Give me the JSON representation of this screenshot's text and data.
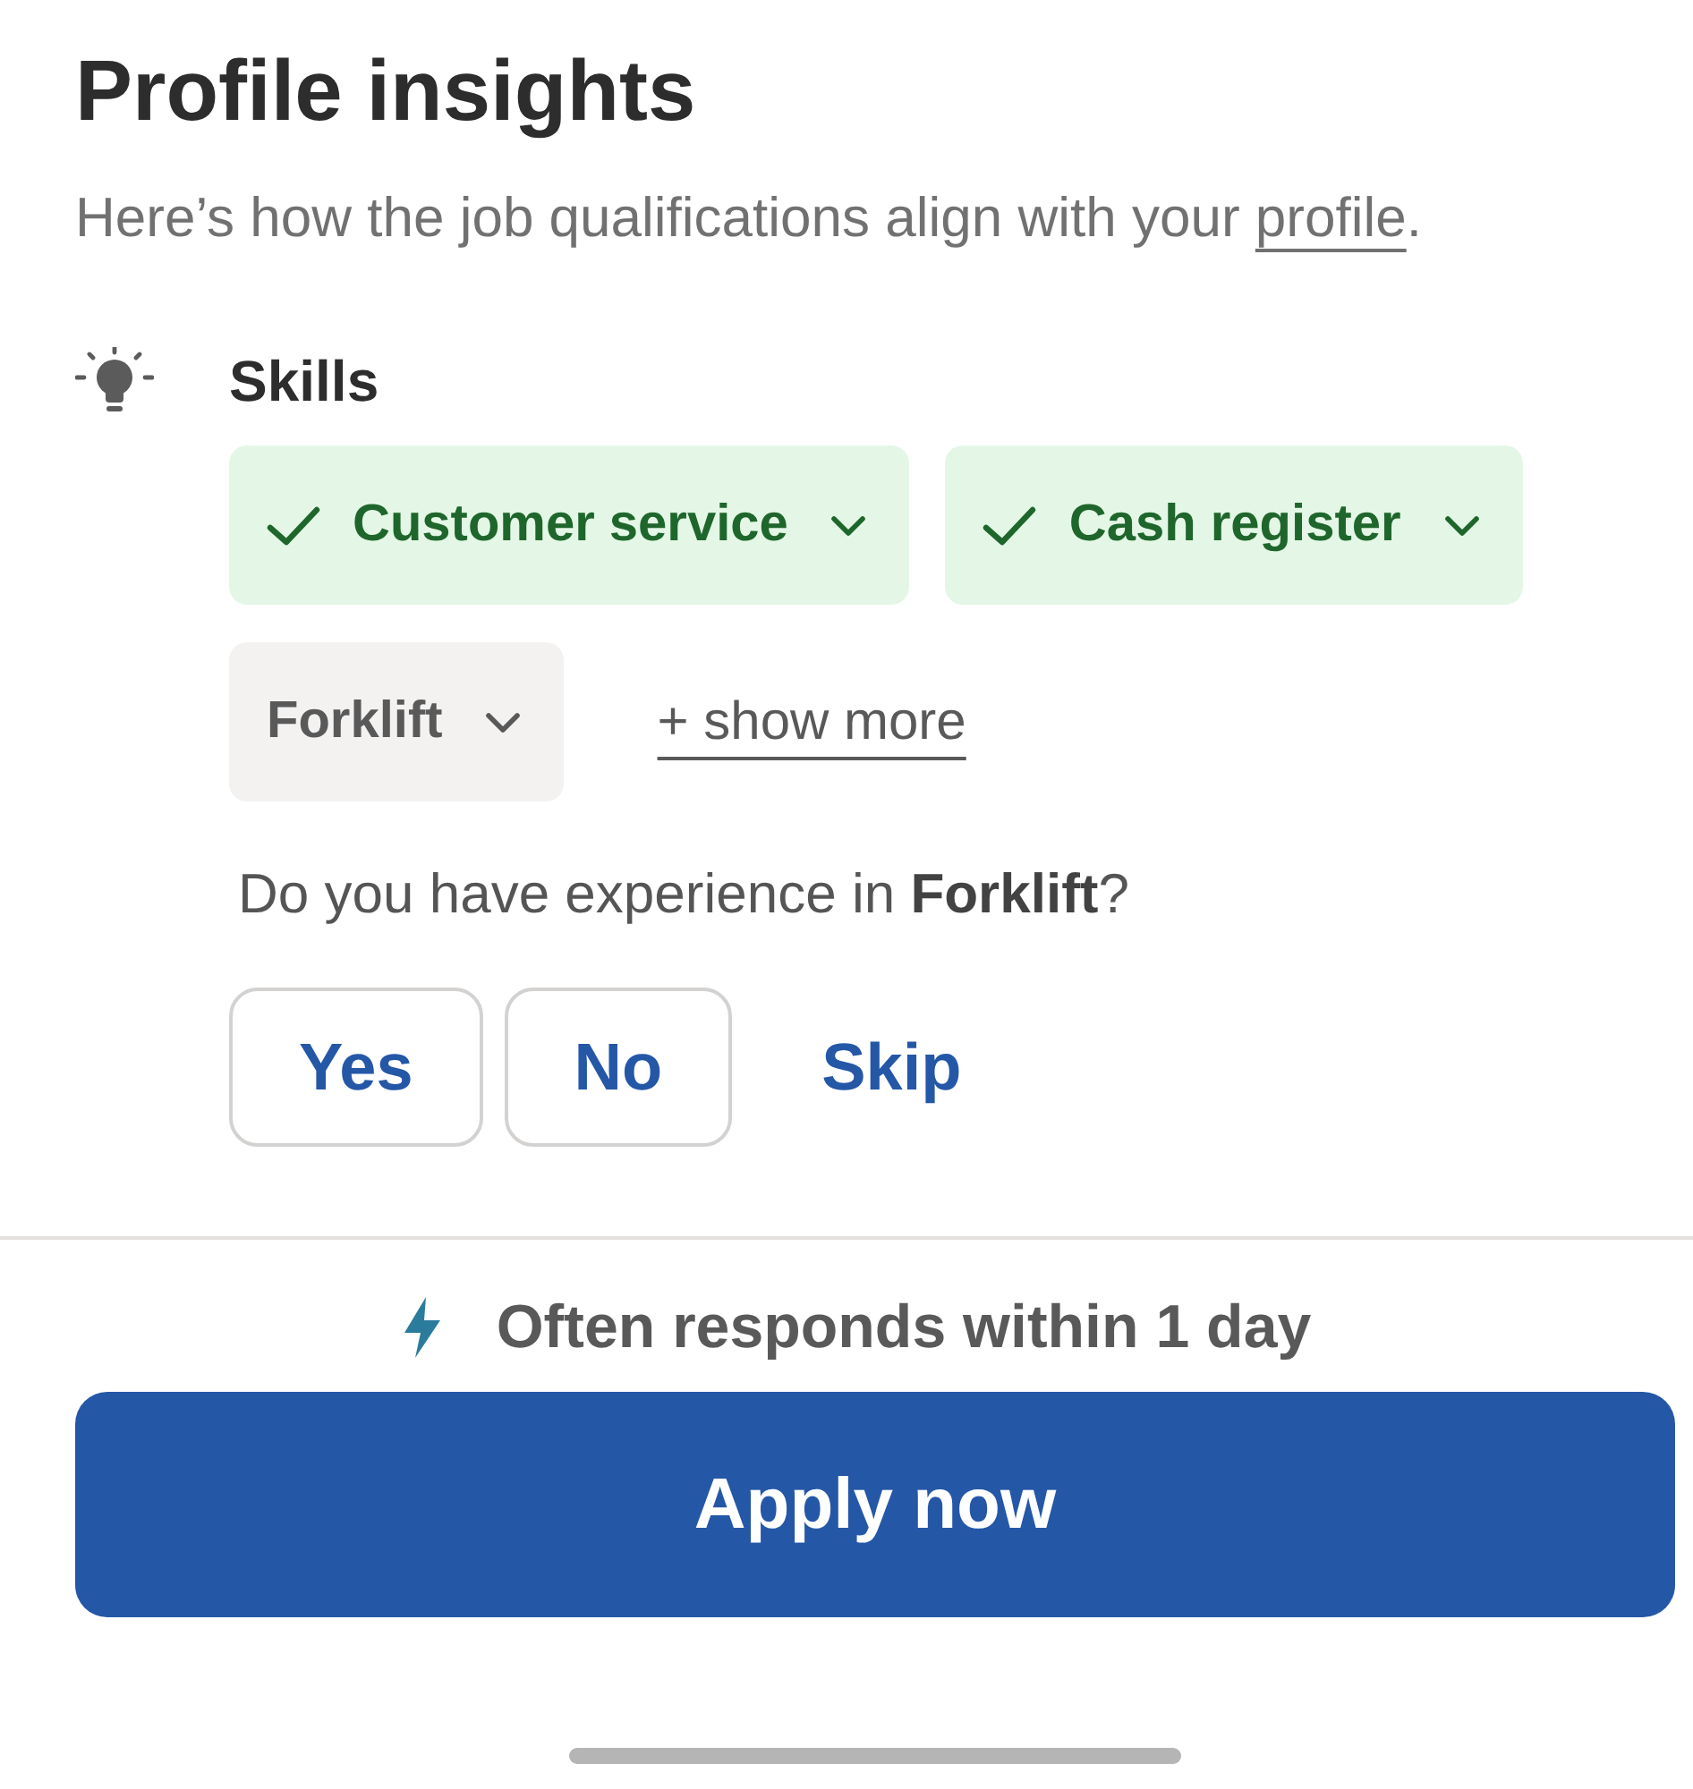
{
  "header": {
    "title": "Profile insights",
    "subtitle": {
      "before": "Here’s how the job qualifications align with your ",
      "link": "profile",
      "after": "."
    }
  },
  "skills_section": {
    "title": "Skills",
    "skills": [
      {
        "label": "Customer service",
        "matched": true
      },
      {
        "label": "Cash register",
        "matched": true
      },
      {
        "label": "Forklift",
        "matched": false
      }
    ],
    "show_more": "+ show more",
    "question": "Do you have experience in **Forklift**?",
    "answers": [
      {
        "label": "Yes",
        "kind": "outlined"
      },
      {
        "label": "No",
        "kind": "outlined"
      },
      {
        "label": "Skip",
        "kind": "text"
      }
    ]
  },
  "footer": {
    "response_note": "Often responds within 1 day",
    "apply_button": "Apply now"
  }
}
